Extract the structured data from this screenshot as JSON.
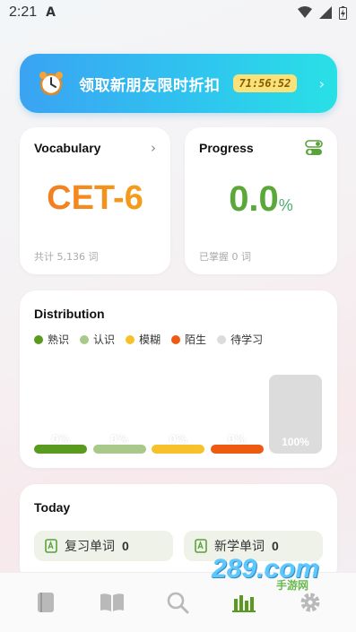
{
  "status_bar": {
    "time": "2:21",
    "a_glyph": "A"
  },
  "promo": {
    "text": "领取新朋友限时折扣",
    "timer": "71:56:52",
    "icon": "alarm-clock-icon"
  },
  "vocabulary": {
    "title": "Vocabulary",
    "level": "CET-6",
    "footer": "共计 5,136 词"
  },
  "progress": {
    "title": "Progress",
    "value": "0.0",
    "unit": "%",
    "footer": "已掌握 0 词"
  },
  "distribution": {
    "title": "Distribution",
    "legend": [
      {
        "label": "熟识",
        "color": "#5a9a1f"
      },
      {
        "label": "认识",
        "color": "#a8c98a"
      },
      {
        "label": "模糊",
        "color": "#f6c12b"
      },
      {
        "label": "陌生",
        "color": "#ee5a12"
      },
      {
        "label": "待学习",
        "color": "#dcdcdc"
      }
    ],
    "bars": [
      {
        "label": "0%",
        "value": 0,
        "color": "#5a9a1f"
      },
      {
        "label": "0%",
        "value": 0,
        "color": "#a8c98a"
      },
      {
        "label": "0%",
        "value": 0,
        "color": "#f6c12b"
      },
      {
        "label": "0%",
        "value": 0,
        "color": "#ee5a12"
      },
      {
        "label": "100%",
        "value": 100,
        "color": "#dcdcdc"
      }
    ]
  },
  "today": {
    "title": "Today",
    "review": {
      "label": "复习单词",
      "count": "0"
    },
    "new": {
      "label": "新学单词",
      "count": "0"
    }
  },
  "watermark": {
    "text": "289.com",
    "sub": "手游网"
  },
  "tabbar": [
    "book-icon",
    "open-book-icon",
    "search-icon",
    "chart-icon",
    "gear-icon"
  ]
}
